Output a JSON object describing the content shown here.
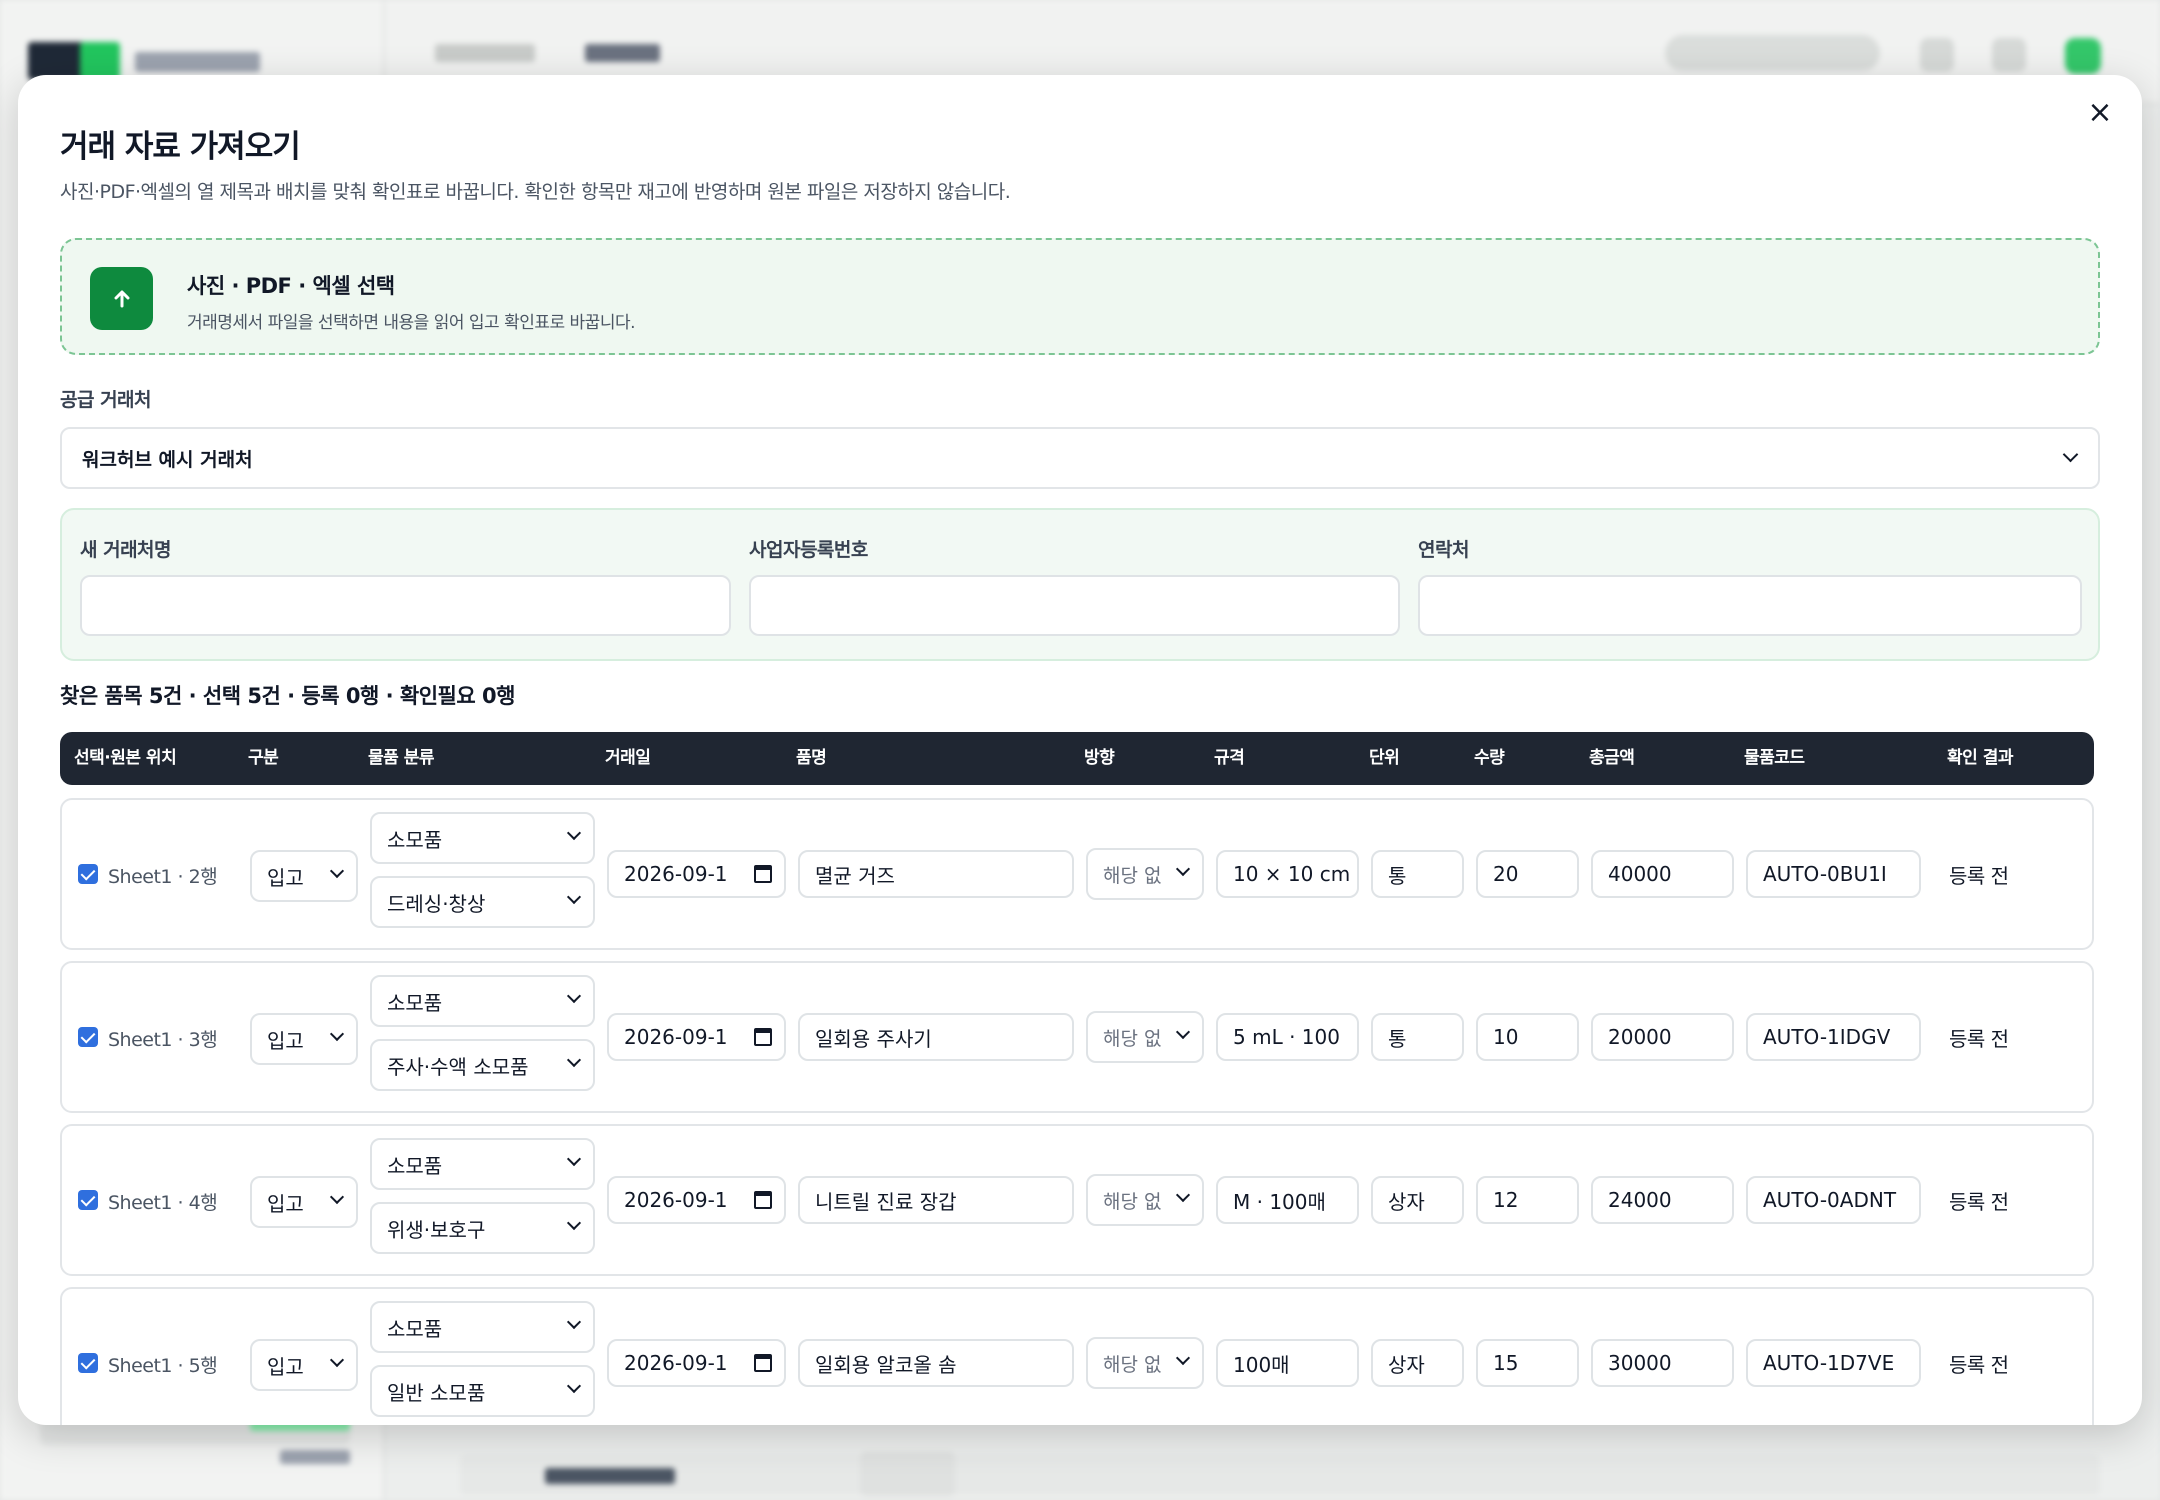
{
  "modal": {
    "title": "거래 자료 가져오기",
    "description": "사진·PDF·엑셀의 열 제목과 배치를 맞춰 확인표로 바꿉니다. 확인한 항목만 재고에 반영하며 원본 파일은 저장하지 않습니다.",
    "close_label": "×"
  },
  "upload": {
    "title": "사진 · PDF · 엑셀 선택",
    "subtitle": "거래명세서 파일을 선택하면 내용을 읽어 입고 확인표로 바꿉니다.",
    "icon": "upload-arrow-icon"
  },
  "supplier": {
    "label": "공급 거래처",
    "selected": "워크허브 예시 거래처"
  },
  "new_supplier": {
    "name_label": "새 거래처명",
    "biz_no_label": "사업자등록번호",
    "contact_label": "연락처",
    "name_value": "",
    "biz_no_value": "",
    "contact_value": ""
  },
  "summary": "찾은 품목 5건 · 선택 5건 · 등록 0행 · 확인필요 0행",
  "table": {
    "headers": [
      "선택·원본 위치",
      "구분",
      "물품 분류",
      "거래일",
      "품명",
      "방향",
      "규격",
      "단위",
      "수량",
      "총금액",
      "물품코드",
      "확인 결과"
    ],
    "rows": [
      {
        "source": "Sheet1 · 2행",
        "type": "입고",
        "category": "소모품",
        "subcategory": "드레싱·창상",
        "date": "2026-09-1",
        "name": "멸균 거즈",
        "direction": "해당 없",
        "spec": "10 × 10 cm",
        "unit": "통",
        "qty": "20",
        "total": "40000",
        "code": "AUTO-0BU1I",
        "status": "등록 전"
      },
      {
        "source": "Sheet1 · 3행",
        "type": "입고",
        "category": "소모품",
        "subcategory": "주사·수액 소모품",
        "date": "2026-09-1",
        "name": "일회용 주사기",
        "direction": "해당 없",
        "spec": "5 mL · 100",
        "unit": "통",
        "qty": "10",
        "total": "20000",
        "code": "AUTO-1IDGV",
        "status": "등록 전"
      },
      {
        "source": "Sheet1 · 4행",
        "type": "입고",
        "category": "소모품",
        "subcategory": "위생·보호구",
        "date": "2026-09-1",
        "name": "니트릴 진료 장갑",
        "direction": "해당 없",
        "spec": "M · 100매",
        "unit": "상자",
        "qty": "12",
        "total": "24000",
        "code": "AUTO-0ADNT",
        "status": "등록 전"
      },
      {
        "source": "Sheet1 · 5행",
        "type": "입고",
        "category": "소모품",
        "subcategory": "일반 소모품",
        "date": "2026-09-1",
        "name": "일회용 알코올 솜",
        "direction": "해당 없",
        "spec": "100매",
        "unit": "상자",
        "qty": "15",
        "total": "30000",
        "code": "AUTO-1D7VE",
        "status": "등록 전"
      }
    ]
  },
  "colors": {
    "accent": "#0e8a3e",
    "table_header": "#1f2632",
    "checkbox": "#2f6fde"
  }
}
